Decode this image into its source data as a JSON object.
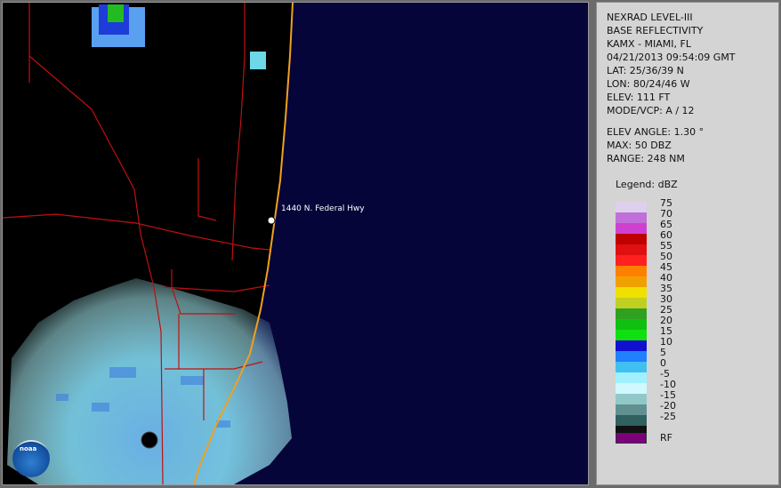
{
  "map": {
    "marker_label": "1440 N. Federal Hwy",
    "logo_text": "noaa",
    "colors": {
      "land": "#000000",
      "ocean": "#05053a",
      "county_lines": "#c01010",
      "coastline": "#f0a020",
      "radar_light": "#9ee8f0",
      "radar_mid": "#5aa0f0",
      "radar_dark": "#1e3cd8",
      "radar_green": "#22bb22"
    }
  },
  "info": {
    "line1": "NEXRAD LEVEL-III",
    "line2": "BASE REFLECTIVITY",
    "line3": "KAMX - MIAMI, FL",
    "line4": "04/21/2013 09:54:09 GMT",
    "line5": "LAT: 25/36/39 N",
    "line6": "LON: 80/24/46 W",
    "line7": "ELEV: 111 FT",
    "line8": "MODE/VCP: A / 12",
    "line9": "ELEV ANGLE: 1.30 °",
    "line10": "MAX: 50 DBZ",
    "line11": "RANGE: 248 NM"
  },
  "legend": {
    "title": "Legend: dBZ",
    "labels": [
      "75",
      "70",
      "65",
      "60",
      "55",
      "50",
      "45",
      "40",
      "35",
      "30",
      "25",
      "20",
      "15",
      "10",
      "5",
      "0",
      "-5",
      "-10",
      "-15",
      "-20",
      "-25"
    ],
    "colors": [
      "#dcd0ec",
      "#c070d8",
      "#d040d0",
      "#c00000",
      "#e01010",
      "#ff2020",
      "#ff8000",
      "#f0a000",
      "#f0e000",
      "#c0d020",
      "#30a020",
      "#10c010",
      "#10e010",
      "#1010d0",
      "#2080ff",
      "#40c0f0",
      "#a0f0ff",
      "#d0f8ff",
      "#90c8c8",
      "#609090",
      "#306060",
      "#101010"
    ],
    "rf_label": "RF",
    "rf_color": "#7a007a"
  }
}
